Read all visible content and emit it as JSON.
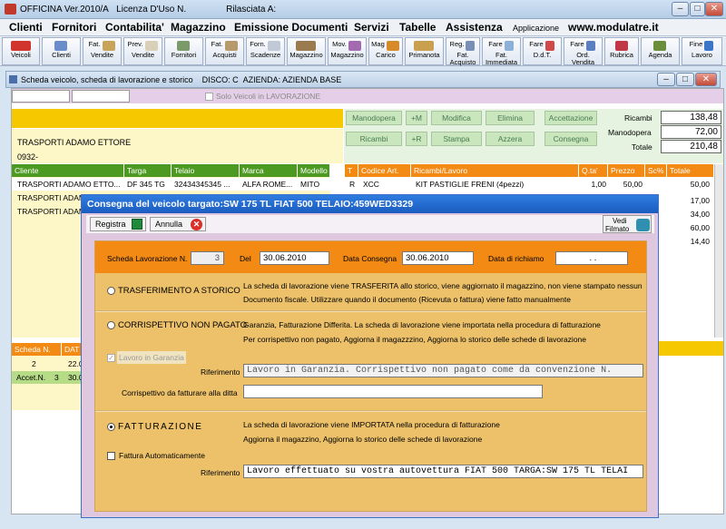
{
  "title": {
    "app": "OFFICINA Ver.2010/A",
    "license": "Licenza D'Uso N.",
    "released": "Rilasciata A:"
  },
  "menu": {
    "items": [
      "Clienti",
      "Fornitori",
      "Contabilita'",
      "Magazzino",
      "Emissione Documenti",
      "Servizi",
      "Tabelle",
      "Assistenza"
    ],
    "app_label": "Applicazione",
    "website": "www.modulatre.it"
  },
  "toolbar": {
    "buttons": [
      {
        "l1": "",
        "l2": "Veicoli"
      },
      {
        "l1": "",
        "l2": "Clienti"
      },
      {
        "l1": "Fat.",
        "l2": "Vendite"
      },
      {
        "l1": "Prev.",
        "l2": "Vendite"
      },
      {
        "l1": "",
        "l2": "Fornitori"
      },
      {
        "l1": "Fat.",
        "l2": "Acquisti"
      },
      {
        "l1": "Forn.",
        "l2": "Scadenze"
      },
      {
        "l1": "",
        "l2": "Magazzino"
      },
      {
        "l1": "Mov.",
        "l2": "Magazzino"
      },
      {
        "l1": "Mag",
        "l2": "Carico"
      },
      {
        "l1": "",
        "l2": "Primanota"
      },
      {
        "l1": "Reg.",
        "l2": "Fat. Acquisto"
      },
      {
        "l1": "Fare",
        "l2": "Fat. Immediata"
      },
      {
        "l1": "Fare",
        "l2": "D.d.T."
      },
      {
        "l1": "Fare",
        "l2": "Ord. Vendita"
      },
      {
        "l1": "",
        "l2": "Rubrica"
      },
      {
        "l1": "",
        "l2": "Agenda"
      },
      {
        "l1": "Fine",
        "l2": "Lavoro"
      }
    ]
  },
  "child_window": {
    "title": "Scheda veicolo, scheda di lavorazione e storico",
    "disco": "DISCO: C",
    "azienda": "AZIENDA: AZIENDA BASE"
  },
  "filter": {
    "only_in_work": "Solo Veicoli in LAVORAZIONE"
  },
  "client": {
    "name": "TRASPORTI ADAMO ETTORE",
    "code": "0932-"
  },
  "actions": {
    "manodopera": "Manodopera",
    "plus_m": "+M",
    "modifica": "Modifica",
    "elimina": "Elimina",
    "accettazione": "Accettazione",
    "ricambi": "Ricambi",
    "plus_r": "+R",
    "stampa": "Stampa",
    "azzera": "Azzera",
    "consegna": "Consegna"
  },
  "totals": {
    "ricambi_label": "Ricambi",
    "ricambi": "138,48",
    "manodopera_label": "Manodopera",
    "manodopera": "72,00",
    "totale_label": "Totale",
    "totale": "210,48"
  },
  "vehicles": {
    "headers": [
      "Cliente",
      "Targa",
      "Telaio",
      "Marca",
      "Modello"
    ],
    "rows": [
      [
        "TRASPORTI ADAMO ETTO...",
        "DF 345 TG",
        "32434345345 ...",
        "ALFA ROME...",
        "MITO"
      ],
      [
        "TRASPORTI ADAMO",
        "",
        "",
        "",
        ""
      ],
      [
        "TRASPORTI ADAMO",
        "",
        "",
        "",
        ""
      ]
    ]
  },
  "parts": {
    "headers": [
      "T",
      "Codice Art.",
      "Ricambi/Lavoro",
      "Q.ta'",
      "Prezzo",
      "Sc%",
      "Totale"
    ],
    "row": [
      "R",
      "XCC",
      "KIT PASTIGLIE FRENI (4pezzi)",
      "1,00",
      "50,00",
      "",
      "50,00"
    ],
    "totals": [
      "50,00",
      "17,00",
      "34,00",
      "60,00",
      "14,40"
    ]
  },
  "history": {
    "headers": [
      "Scheda N.",
      "DAT"
    ],
    "rows": [
      [
        "2",
        "22.0"
      ],
      [
        "Accet.N.",
        "3",
        "30.0"
      ]
    ]
  },
  "dialog": {
    "title": "Consegna del veicolo targato:SW 175 TL FIAT 500   TELAIO:459WED3329",
    "registra": "Registra",
    "annulla": "Annulla",
    "vedi": "Vedi",
    "filmato": "Filmato",
    "scheda_label": "Scheda Lavorazione N.",
    "scheda_value": "3",
    "del_label": "Del",
    "del_value": "30.06.2010",
    "consegna_label": "Data Consegna",
    "consegna_value": "30.06.2010",
    "richiamo_label": "Data di richiamo",
    "richiamo_value": ".  .",
    "opt1_label": "TRASFERIMENTO A STORICO",
    "opt1_desc1": "La scheda di lavorazione viene TRASFERITA allo storico, viene aggiornato il magazzino, non viene stampato nessun",
    "opt1_desc2": "Documento fiscale. Utilizzare quando il documento (Ricevuta o fattura) viene fatto manualmente",
    "opt2_label": "CORRISPETTIVO NON PAGATO",
    "opt2_desc1": "Garanzia, Fatturazione Differita. La scheda di lavorazione viene importata nella procedura di fatturazione",
    "opt2_desc2": "Per corrispettivo non pagato, Aggiorna il magazzzino, Aggiorna lo storico delle schede di lavorazione",
    "garanzia_label": "Lavoro in Garanzia",
    "riferimento_label": "Riferimento",
    "riferimento1_value": "Lavoro in Garanzia. Corrispettivo non pagato come da convenzione N.",
    "corrispettivo_label": "Corrispettivo da fatturare alla ditta",
    "corrispettivo_value": "",
    "opt3_label": "FATTURAZIONE",
    "opt3_desc1": "La scheda di lavorazione viene IMPORTATA nella procedura di fatturazione",
    "opt3_desc2": "Aggiorna il magazzino, Aggiorna lo storico delle schede di lavorazione",
    "fattura_auto_label": "Fattura Automaticamente",
    "riferimento2_value": "Lavoro effettuato su vostra autovettura FIAT 500 TARGA:SW 175 TL TELAI"
  }
}
